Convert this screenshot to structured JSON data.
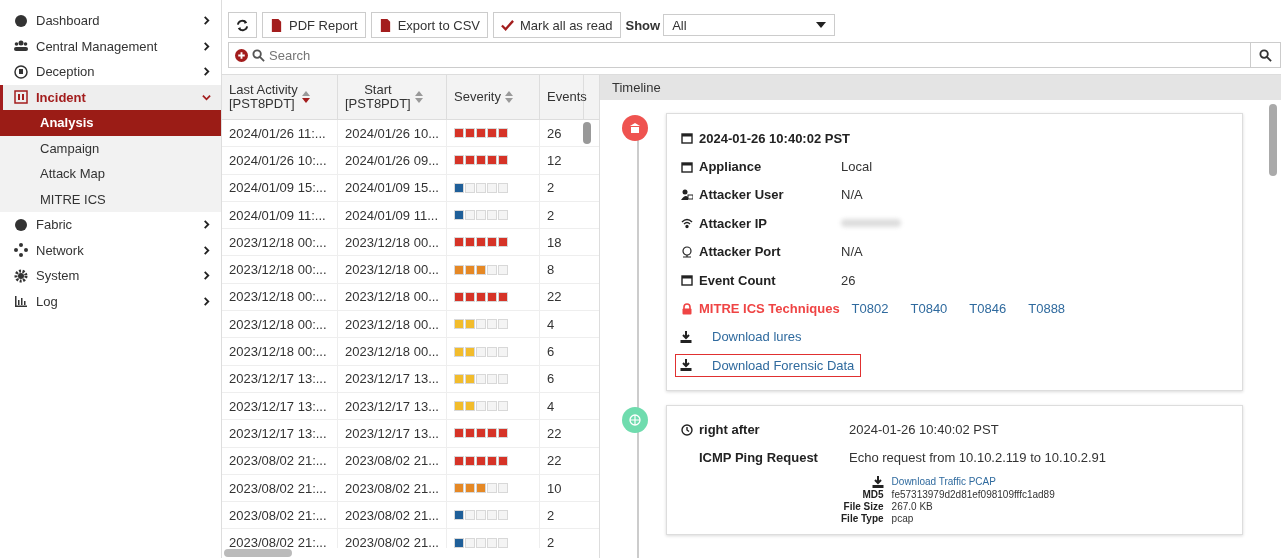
{
  "sidebar": {
    "items": [
      {
        "label": "Dashboard",
        "expanded": false
      },
      {
        "label": "Central Management",
        "expanded": false
      },
      {
        "label": "Deception",
        "expanded": false
      },
      {
        "label": "Incident",
        "expanded": true,
        "children": [
          {
            "label": "Analysis",
            "selected": true
          },
          {
            "label": "Campaign",
            "selected": false
          },
          {
            "label": "Attack Map",
            "selected": false
          },
          {
            "label": "MITRE ICS",
            "selected": false
          }
        ]
      },
      {
        "label": "Fabric",
        "expanded": false
      },
      {
        "label": "Network",
        "expanded": false
      },
      {
        "label": "System",
        "expanded": false
      },
      {
        "label": "Log",
        "expanded": false
      }
    ]
  },
  "toolbar": {
    "buttons": [
      {
        "kind": "refresh"
      },
      {
        "kind": "pdf",
        "label": "PDF Report"
      },
      {
        "kind": "csv",
        "label": "Export to CSV"
      },
      {
        "kind": "check",
        "label": "Mark all as read"
      }
    ],
    "show_label": "Show",
    "show_value": "All"
  },
  "search": {
    "placeholder": "Search"
  },
  "table": {
    "columns": [
      {
        "label": "Last Activity",
        "sub": "[PST8PDT]",
        "sorted": true
      },
      {
        "label": "Start",
        "sub": "[PST8PDT]",
        "sorted": false
      },
      {
        "label": "Severity",
        "sorted": false
      },
      {
        "label": "Events"
      }
    ],
    "rows": [
      {
        "last": "2024/01/26 11:...",
        "start": "2024/01/26 10...",
        "stars": 5,
        "color": "#d63327",
        "events": "26"
      },
      {
        "last": "2024/01/26 10:...",
        "start": "2024/01/26 09...",
        "stars": 5,
        "color": "#d63327",
        "events": "12"
      },
      {
        "last": "2024/01/09 15:...",
        "start": "2024/01/09 15...",
        "stars": 1,
        "color": "#1f5f99",
        "events": "2"
      },
      {
        "last": "2024/01/09 11:...",
        "start": "2024/01/09 11...",
        "stars": 1,
        "color": "#1f5f99",
        "events": "2"
      },
      {
        "last": "2023/12/18 00:...",
        "start": "2023/12/18 00...",
        "stars": 5,
        "color": "#d63327",
        "events": "18"
      },
      {
        "last": "2023/12/18 00:...",
        "start": "2023/12/18 00...",
        "stars": 3,
        "color": "#e58825",
        "events": "8"
      },
      {
        "last": "2023/12/18 00:...",
        "start": "2023/12/18 00...",
        "stars": 5,
        "color": "#d63327",
        "events": "22"
      },
      {
        "last": "2023/12/18 00:...",
        "start": "2023/12/18 00...",
        "stars": 2,
        "color": "#f2bc2c",
        "events": "4"
      },
      {
        "last": "2023/12/18 00:...",
        "start": "2023/12/18 00...",
        "stars": 2,
        "color": "#f2bc2c",
        "events": "6"
      },
      {
        "last": "2023/12/17 13:...",
        "start": "2023/12/17 13...",
        "stars": 2,
        "color": "#f2bc2c",
        "events": "6"
      },
      {
        "last": "2023/12/17 13:...",
        "start": "2023/12/17 13...",
        "stars": 2,
        "color": "#f2bc2c",
        "events": "4"
      },
      {
        "last": "2023/12/17 13:...",
        "start": "2023/12/17 13...",
        "stars": 5,
        "color": "#d63327",
        "events": "22"
      },
      {
        "last": "2023/08/02 21:...",
        "start": "2023/08/02 21...",
        "stars": 5,
        "color": "#d63327",
        "events": "22"
      },
      {
        "last": "2023/08/02 21:...",
        "start": "2023/08/02 21...",
        "stars": 3,
        "color": "#e58825",
        "events": "10"
      },
      {
        "last": "2023/08/02 21:...",
        "start": "2023/08/02 21...",
        "stars": 1,
        "color": "#1f5f99",
        "events": "2"
      },
      {
        "last": "2023/08/02 21:...",
        "start": "2023/08/02 21...",
        "stars": 1,
        "color": "#1f5f99",
        "events": "2"
      }
    ]
  },
  "timeline": {
    "title": "Timeline",
    "cards": [
      {
        "kind": "incident",
        "color": "#ef5350",
        "heading": "2024-01-26 10:40:02 PST",
        "fields": [
          {
            "label": "Appliance",
            "value": "Local"
          },
          {
            "label": "Attacker User",
            "value": "N/A"
          },
          {
            "label": "Attacker IP",
            "blurred": true
          },
          {
            "label": "Attacker Port",
            "value": "N/A"
          },
          {
            "label": "Event Count",
            "value": "26"
          }
        ],
        "techniques_label": "MITRE ICS Techniques",
        "techniques": [
          "T0802",
          "T0840",
          "T0846",
          "T0888"
        ],
        "downloads": [
          {
            "label": "Download lures",
            "highlighted": false
          },
          {
            "label": "Download Forensic Data",
            "highlighted": true
          }
        ]
      },
      {
        "kind": "event",
        "color": "#6fdcae",
        "time_label": "right after",
        "time": "2024-01-26 10:40:02 PST",
        "event_label": "ICMP Ping Request",
        "event_text": "Echo request from 10.10.2.119 to 10.10.2.91",
        "download": "Download Traffic PCAP",
        "file": [
          {
            "label": "MD5",
            "value": "fe57313979d2d81ef098109fffc1ad89"
          },
          {
            "label": "File Size",
            "value": "267.0 KB"
          },
          {
            "label": "File Type",
            "value": "pcap"
          }
        ]
      }
    ]
  }
}
